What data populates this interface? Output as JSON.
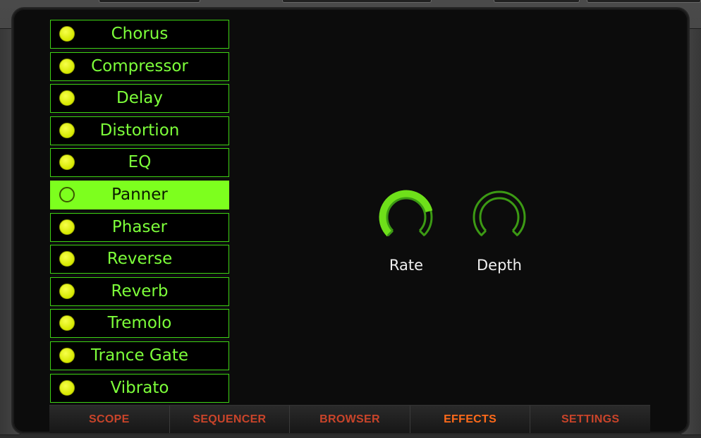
{
  "effects": [
    {
      "label": "Chorus",
      "active": false
    },
    {
      "label": "Compressor",
      "active": false
    },
    {
      "label": "Delay",
      "active": false
    },
    {
      "label": "Distortion",
      "active": false
    },
    {
      "label": "EQ",
      "active": false
    },
    {
      "label": "Panner",
      "active": true
    },
    {
      "label": "Phaser",
      "active": false
    },
    {
      "label": "Reverse",
      "active": false
    },
    {
      "label": "Reverb",
      "active": false
    },
    {
      "label": "Tremolo",
      "active": false
    },
    {
      "label": "Trance Gate",
      "active": false
    },
    {
      "label": "Vibrato",
      "active": false
    }
  ],
  "knobs": {
    "rate": {
      "label": "Rate",
      "value": 0.78,
      "color": "#6ee01a"
    },
    "depth": {
      "label": "Depth",
      "value": 0.0,
      "color": "#3c9a14"
    }
  },
  "tabs": [
    {
      "label": "SCOPE",
      "active": false
    },
    {
      "label": "SEQUENCER",
      "active": false
    },
    {
      "label": "BROWSER",
      "active": false
    },
    {
      "label": "EFFECTS",
      "active": true
    },
    {
      "label": "SETTINGS",
      "active": false
    }
  ],
  "colors": {
    "accent_green": "#7dff1e",
    "led_yellow": "#e6f500",
    "tab_text": "#c9442a",
    "tab_active": "#ff6a1a"
  }
}
